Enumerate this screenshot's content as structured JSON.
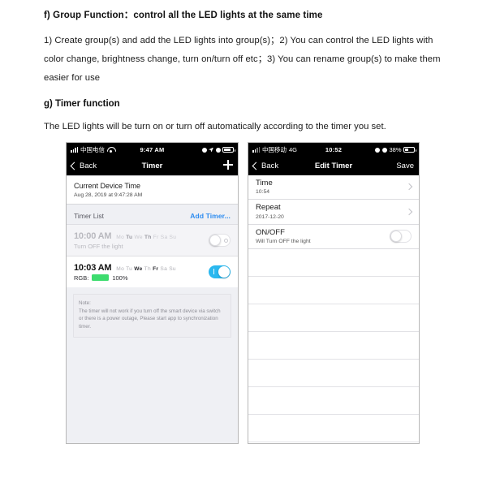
{
  "document": {
    "heading_f": "f) Group Function：control all the LED lights at the same time",
    "paragraph_f": "1) Create group(s) and add the LED lights into group(s)；2) You can control the LED lights with color change, brightness change, turn on/turn off  etc；3) You can rename group(s) to make them easier for use",
    "heading_g": "g)  Timer function",
    "paragraph_g": "The LED lights will be turn on or turn off automatically according to the timer you set."
  },
  "phone_left": {
    "status_bar": {
      "carrier": "中国电信",
      "wifi_icon": "wifi-icon",
      "time": "9:47 AM",
      "lock_icon": "rotation-lock-icon",
      "location_icon": "location-arrow-icon",
      "alarm_icon": "alarm-icon",
      "battery_icon": "battery-icon"
    },
    "nav": {
      "back_label": "Back",
      "back_icon": "chevron-left-icon",
      "title": "Timer",
      "add_icon": "plus-icon"
    },
    "current_device_time": {
      "title": "Current Device Time",
      "value": "Aug 28, 2019 at 9:47:28 AM"
    },
    "timer_list": {
      "label": "Timer List",
      "add_label": "Add Timer..."
    },
    "timers": [
      {
        "time": "10:00 AM",
        "days": [
          {
            "label": "Mo",
            "on": false
          },
          {
            "label": "Tu",
            "on": true
          },
          {
            "label": "We",
            "on": false
          },
          {
            "label": "Th",
            "on": true
          },
          {
            "label": "Fr",
            "on": false
          },
          {
            "label": "Sa",
            "on": false
          },
          {
            "label": "Su",
            "on": false
          }
        ],
        "subtitle": "Turn OFF the light",
        "enabled": false,
        "has_rgb": false
      },
      {
        "time": "10:03 AM",
        "days": [
          {
            "label": "Mo",
            "on": false
          },
          {
            "label": "Tu",
            "on": false
          },
          {
            "label": "We",
            "on": true
          },
          {
            "label": "Th",
            "on": false
          },
          {
            "label": "Fr",
            "on": true
          },
          {
            "label": "Sa",
            "on": false
          },
          {
            "label": "Su",
            "on": false
          }
        ],
        "rgb_label": "RGB:",
        "rgb_color": "#3ddc6e",
        "brightness": "100%",
        "enabled": true,
        "has_rgb": true
      }
    ],
    "note": {
      "title": "Note:",
      "text": "The timer will not work if you turn off the smart device via switch or there is a power outage, Please start app to synchronization timer."
    }
  },
  "phone_right": {
    "status_bar": {
      "carrier": "中国移动",
      "network": "4G",
      "time": "10:52",
      "lock_icon": "rotation-lock-icon",
      "alarm_icon": "alarm-icon",
      "battery_percent": "38%",
      "battery_icon": "battery-icon"
    },
    "nav": {
      "back_label": "Back",
      "back_icon": "chevron-left-icon",
      "title": "Edit Timer",
      "save_label": "Save"
    },
    "rows": [
      {
        "title": "Time",
        "sub": "10:54",
        "type": "disclosure"
      },
      {
        "title": "Repeat",
        "sub": "2017-12-20",
        "type": "disclosure"
      },
      {
        "title": "ON/OFF",
        "sub": "Will Turn OFF the light",
        "type": "switch",
        "enabled": false
      }
    ],
    "empty_row_count": 7
  },
  "colors": {
    "accent_blue": "#2d8cf0",
    "switch_on": "#2bb8ef",
    "rgb_green": "#3ddc6e",
    "status_bar": "#000000"
  }
}
